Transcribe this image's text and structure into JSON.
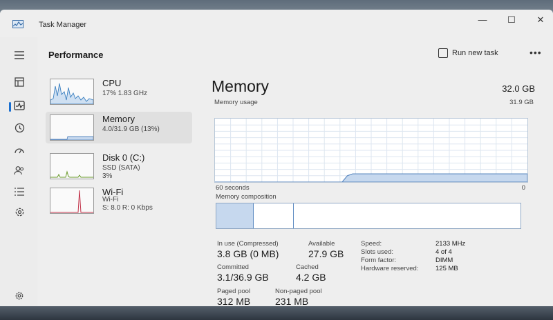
{
  "window": {
    "title": "Task Manager",
    "controls": {
      "minimize": "—",
      "maximize": "☐",
      "close": "✕"
    }
  },
  "nav": {
    "items": [
      {
        "name": "hamburger-icon"
      },
      {
        "name": "processes-icon"
      },
      {
        "name": "performance-icon",
        "selected": true
      },
      {
        "name": "app-history-icon"
      },
      {
        "name": "startup-apps-icon"
      },
      {
        "name": "users-icon"
      },
      {
        "name": "details-icon"
      },
      {
        "name": "services-icon"
      }
    ],
    "settings_icon": "gear-icon"
  },
  "header": {
    "page_title": "Performance",
    "run_new_task": "Run new task",
    "more": "•••"
  },
  "perf_list": [
    {
      "name": "CPU",
      "sub1": "17% 1.83 GHz",
      "sub2": "",
      "sub3": ""
    },
    {
      "name": "Memory",
      "sub1": "4.0/31.9 GB (13%)",
      "sub2": "",
      "sub3": "",
      "selected": true
    },
    {
      "name": "Disk 0 (C:)",
      "sub1": "SSD (SATA)",
      "sub2": "3%",
      "sub3": ""
    },
    {
      "name": "Wi-Fi",
      "sub1": "Wi-Fi",
      "sub2": "S: 8.0  R: 0 Kbps",
      "sub3": ""
    }
  ],
  "memory": {
    "title": "Memory",
    "total": "32.0 GB",
    "usage_label": "Memory usage",
    "usage_max": "31.9 GB",
    "x_left": "60 seconds",
    "x_right": "0",
    "composition_label": "Memory composition",
    "composition_fractions": {
      "in_use": 0.12,
      "modified": 0.13
    },
    "usage_history_fraction": [
      0,
      0,
      0,
      0,
      0,
      0,
      0,
      0,
      0,
      0,
      0,
      0,
      0,
      0,
      0,
      0,
      0,
      0,
      0,
      0,
      0,
      0,
      0,
      0,
      0.0,
      0.1,
      0.13,
      0.13,
      0.13,
      0.13,
      0.13,
      0.13,
      0.13,
      0.13,
      0.13,
      0.13,
      0.13,
      0.13,
      0.13,
      0.13,
      0.13,
      0.13,
      0.13,
      0.13,
      0.13,
      0.13,
      0.13,
      0.13,
      0.13,
      0.13,
      0.13,
      0.13,
      0.13,
      0.13,
      0.13,
      0.13,
      0.13,
      0.13,
      0.13,
      0.13
    ],
    "stats": {
      "in_use_label": "In use (Compressed)",
      "in_use_value": "3.8 GB (0 MB)",
      "available_label": "Available",
      "available_value": "27.9 GB",
      "committed_label": "Committed",
      "committed_value": "3.1/36.9 GB",
      "cached_label": "Cached",
      "cached_value": "4.2 GB",
      "paged_label": "Paged pool",
      "paged_value": "312 MB",
      "nonpaged_label": "Non-paged pool",
      "nonpaged_value": "231 MB"
    },
    "specs": {
      "speed_label": "Speed:",
      "speed_value": "2133 MHz",
      "slots_label": "Slots used:",
      "slots_value": "4 of 4",
      "form_label": "Form factor:",
      "form_value": "DIMM",
      "reserved_label": "Hardware reserved:",
      "reserved_value": "125 MB"
    }
  },
  "colors": {
    "accent": "#1a6fd0",
    "memory_line": "#5f8cc2",
    "memory_fill": "#c6d8ee",
    "cpu_line": "#3a7fc0",
    "disk_line": "#6a9a2a",
    "wifi_line": "#c2334a"
  }
}
